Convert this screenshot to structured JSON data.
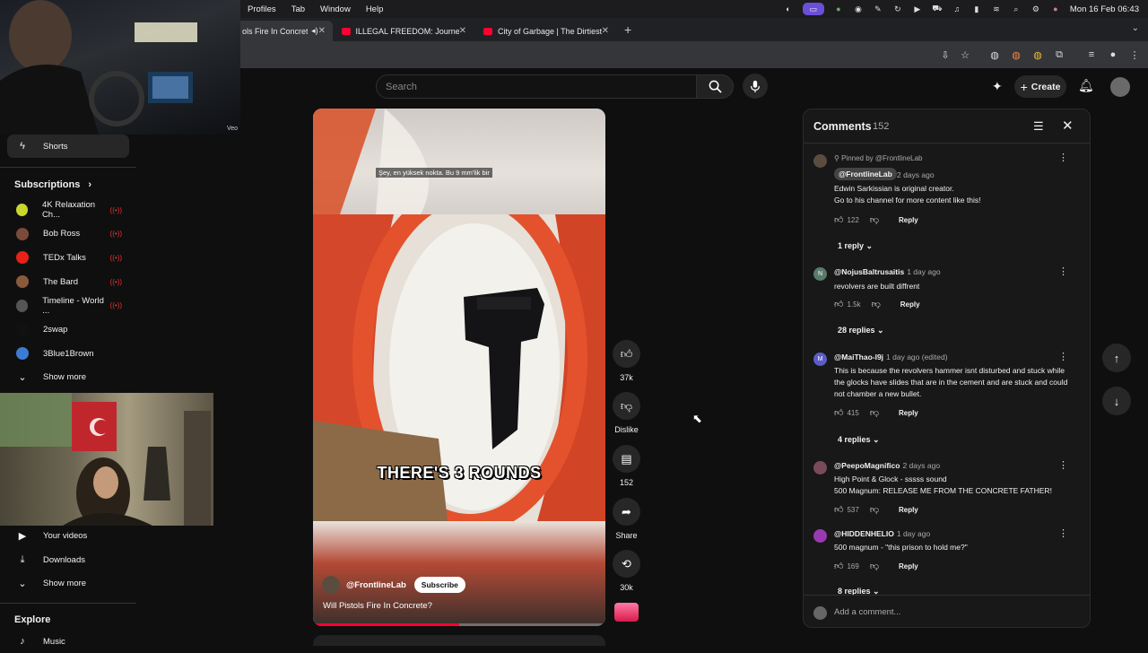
{
  "menubar": {
    "items": [
      "Profiles",
      "Tab",
      "Window",
      "Help"
    ],
    "datetime": "Mon 16 Feb 06:43"
  },
  "tabs": [
    {
      "title": "ols Fire In Concret",
      "active": true
    },
    {
      "title": "ILLEGAL FREEDOM: Journey",
      "active": false
    },
    {
      "title": "City of Garbage | The Dirtiest",
      "active": false
    }
  ],
  "header": {
    "search_placeholder": "Search",
    "create_label": "Create"
  },
  "cam1_label": "Veo",
  "sidebar": {
    "shorts_label": "Shorts",
    "subscriptions_heading": "Subscriptions",
    "subscriptions": [
      {
        "name": "4K Relaxation Ch...",
        "live": true,
        "color": "#c9d62c"
      },
      {
        "name": "Bob Ross",
        "live": true,
        "color": "#7a4a3a"
      },
      {
        "name": "TEDx Talks",
        "live": true,
        "color": "#e62117"
      },
      {
        "name": "The Bard",
        "live": true,
        "color": "#8a5a3a"
      },
      {
        "name": "Timeline - World ...",
        "live": true,
        "color": "#555555"
      },
      {
        "name": "2swap",
        "live": false,
        "color": "#111111"
      },
      {
        "name": "3Blue1Brown",
        "live": false,
        "color": "#3a7bd5"
      }
    ],
    "show_more_1": "Show more",
    "your_videos": "Your videos",
    "downloads": "Downloads",
    "show_more_2": "Show more",
    "explore_heading": "Explore",
    "music": "Music"
  },
  "video": {
    "subtitle": "Şey, en yüksek nokta.  Bu 9 mm'lik bir",
    "caption": "THERE'S 3 ROUNDS",
    "channel": "@FrontlineLab",
    "subscribe_label": "Subscribe",
    "title": "Will Pistols Fire In Concrete?",
    "progress": 0.5
  },
  "actions": {
    "likes": "37k",
    "dislike_label": "Dislike",
    "comments": "152",
    "share_label": "Share",
    "remix": "30k"
  },
  "comments": {
    "title": "Comments",
    "count": "152",
    "add_placeholder": "Add a comment...",
    "items": [
      {
        "pinned": "Pinned by @FrontlineLab",
        "author": "@FrontlineLab",
        "time": "2 days ago",
        "text1": "Edwin Sarkissian is original creator.",
        "text2": "Go to his channel for more content like this!",
        "likes": "122",
        "reply": "Reply",
        "replies": "1 reply"
      },
      {
        "author": "@NojusBaltrusaitis",
        "time": "1 day ago",
        "initial": "N",
        "text1": "revolvers are built diffrent",
        "likes": "1.5k",
        "reply": "Reply",
        "replies": "28 replies"
      },
      {
        "author": "@MaiThao-l9j",
        "time": "1 day ago (edited)",
        "initial": "M",
        "text1": "This is because the revolvers hammer isnt disturbed and stuck while the glocks have slides that are in the cement and are stuck and could not chamber a new bullet.",
        "likes": "415",
        "reply": "Reply",
        "replies": "4 replies"
      },
      {
        "author": "@PeepoMagnifico",
        "time": "2 days ago",
        "text1": "High Point & Glock - sssss sound",
        "text2": "500 Magnum: RELEASE ME FROM THE CONCRETE FATHER!",
        "likes": "537",
        "reply": "Reply"
      },
      {
        "author": "@HIDDENHELIO",
        "time": "1 day ago",
        "text1": "500 magnum - \"this prison to hold me?\"",
        "likes": "169",
        "reply": "Reply",
        "replies": "8 replies"
      }
    ]
  },
  "colors": {
    "accent": "#ff0033",
    "background": "#0f0f0f",
    "panel": "#181818"
  }
}
